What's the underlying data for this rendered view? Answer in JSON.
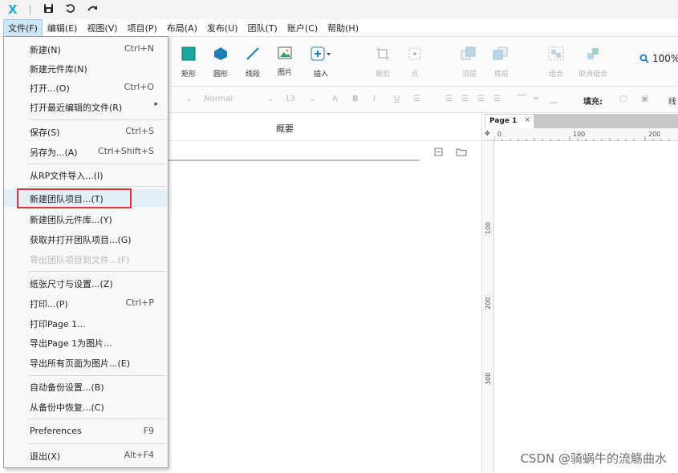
{
  "titlebar": {
    "logo": "X"
  },
  "menubar": [
    "文件(F)",
    "编辑(E)",
    "视图(V)",
    "项目(P)",
    "布局(A)",
    "发布(U)",
    "团队(T)",
    "账户(C)",
    "帮助(H)"
  ],
  "toolbar": {
    "tools": [
      "矩形",
      "圆形",
      "线段",
      "图片",
      "插入",
      "裁剪",
      "点",
      "顶层",
      "底层",
      "组合",
      "取消组合"
    ],
    "zoom": "100%"
  },
  "formatbar": {
    "font_style": "Normal",
    "font_size": "13",
    "fill_label": "填充:",
    "line_label": "线"
  },
  "panel": {
    "title": "概要"
  },
  "canvas": {
    "tab": "Page 1",
    "tab_close": "×",
    "ruler_top": [
      "0",
      "100",
      "200"
    ],
    "ruler_left": [
      "100",
      "200",
      "300"
    ]
  },
  "file_menu": [
    {
      "label": "新建(N)",
      "shortcut": "Ctrl+N"
    },
    {
      "label": "新建元件库(N)",
      "shortcut": ""
    },
    {
      "label": "打开...(O)",
      "shortcut": "Ctrl+O"
    },
    {
      "label": "打开最近编辑的文件(R)",
      "shortcut": "▸"
    },
    {
      "label": "保存(S)",
      "shortcut": "Ctrl+S"
    },
    {
      "label": "另存为...(A)",
      "shortcut": "Ctrl+Shift+S"
    },
    {
      "label": "从RP文件导入...(I)",
      "shortcut": ""
    },
    {
      "label": "新建团队项目...(T)",
      "shortcut": ""
    },
    {
      "label": "新建团队元件库...(Y)",
      "shortcut": ""
    },
    {
      "label": "获取并打开团队项目...(G)",
      "shortcut": ""
    },
    {
      "label": "导出团队项目到文件...(F)",
      "shortcut": ""
    },
    {
      "label": "纸张尺寸与设置...(Z)",
      "shortcut": ""
    },
    {
      "label": "打印...(P)",
      "shortcut": "Ctrl+P"
    },
    {
      "label": "打印Page 1...",
      "shortcut": ""
    },
    {
      "label": "导出Page 1为图片...",
      "shortcut": ""
    },
    {
      "label": "导出所有页面为图片...(E)",
      "shortcut": ""
    },
    {
      "label": "自动备份设置...(B)",
      "shortcut": ""
    },
    {
      "label": "从备份中恢复...(C)",
      "shortcut": ""
    },
    {
      "label": "Preferences",
      "shortcut": "F9"
    },
    {
      "label": "退出(X)",
      "shortcut": "Alt+F4"
    }
  ],
  "watermark": "CSDN @骑蜗牛的流觞曲水"
}
